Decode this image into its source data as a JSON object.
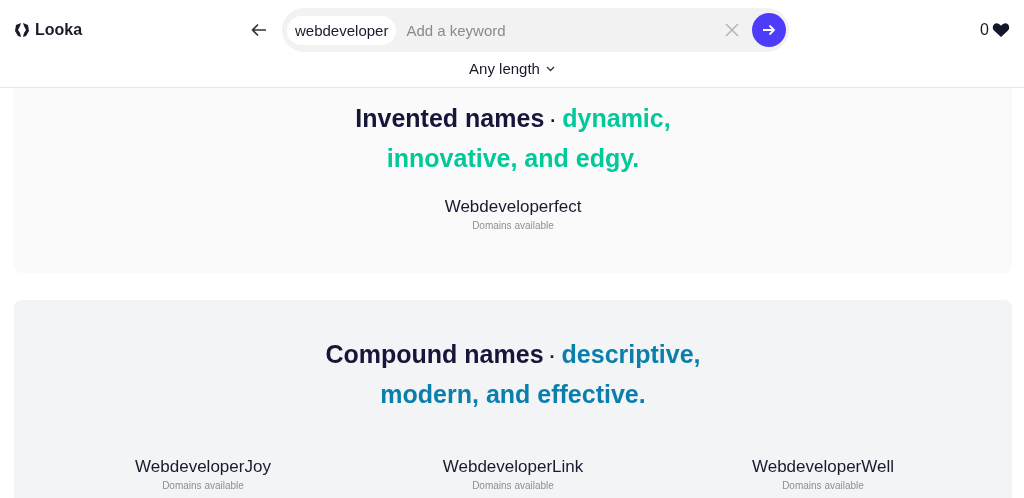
{
  "header": {
    "logo": "Looka",
    "search": {
      "chip": "webdeveloper",
      "placeholder": "Add a keyword"
    },
    "favorites_count": "0",
    "length_filter": "Any length"
  },
  "sections": [
    {
      "title": "Invented names",
      "separator": "·",
      "tagline": "dynamic, innovative, and edgy.",
      "color": "#00c99a",
      "names": [
        {
          "name": "Webdeveloperfect",
          "status": "Domains available"
        }
      ]
    },
    {
      "title": "Compound names",
      "separator": "·",
      "tagline": "descriptive, modern, and effective.",
      "color": "#0a7fab",
      "names": [
        {
          "name": "WebdeveloperJoy",
          "status": "Domains available"
        },
        {
          "name": "WebdeveloperLink",
          "status": "Domains available"
        },
        {
          "name": "WebdeveloperWell",
          "status": "Domains available"
        }
      ]
    }
  ]
}
